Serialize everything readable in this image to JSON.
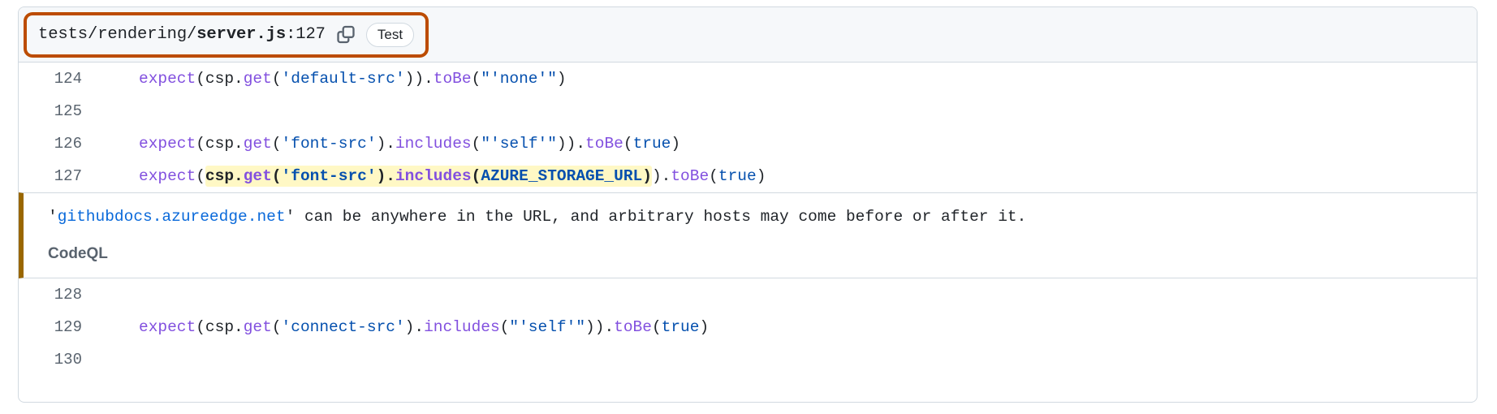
{
  "header": {
    "path_prefix": "tests/rendering/",
    "path_file": "server.js",
    "path_line": ":127",
    "copy_icon": "copy-icon",
    "badge_label": "Test"
  },
  "colors": {
    "focus_ring": "#bc4c00",
    "annotation_border": "#9a6700",
    "highlight": "#fff8c5",
    "link": "#0969da",
    "keyword": "#8250df",
    "string": "#0550ae",
    "header_bg": "#f6f8fa",
    "border": "#d1d9e0",
    "line_number": "#59636e"
  },
  "code": {
    "lines": [
      {
        "number": "124",
        "tokens": [
          {
            "text": "expect",
            "cls": "t-fn"
          },
          {
            "text": "(",
            "cls": "t-punct"
          },
          {
            "text": "csp",
            "cls": "t-id"
          },
          {
            "text": ".",
            "cls": "t-punct"
          },
          {
            "text": "get",
            "cls": "t-fn"
          },
          {
            "text": "(",
            "cls": "t-punct"
          },
          {
            "text": "'default-src'",
            "cls": "t-str"
          },
          {
            "text": "))",
            "cls": "t-punct"
          },
          {
            "text": ".",
            "cls": "t-punct"
          },
          {
            "text": "toBe",
            "cls": "t-fn"
          },
          {
            "text": "(",
            "cls": "t-punct"
          },
          {
            "text": "\"'none'\"",
            "cls": "t-str"
          },
          {
            "text": ")",
            "cls": "t-punct"
          }
        ]
      },
      {
        "number": "125",
        "tokens": []
      },
      {
        "number": "126",
        "tokens": [
          {
            "text": "expect",
            "cls": "t-fn"
          },
          {
            "text": "(",
            "cls": "t-punct"
          },
          {
            "text": "csp",
            "cls": "t-id"
          },
          {
            "text": ".",
            "cls": "t-punct"
          },
          {
            "text": "get",
            "cls": "t-fn"
          },
          {
            "text": "(",
            "cls": "t-punct"
          },
          {
            "text": "'font-src'",
            "cls": "t-str"
          },
          {
            "text": ")",
            "cls": "t-punct"
          },
          {
            "text": ".",
            "cls": "t-punct"
          },
          {
            "text": "includes",
            "cls": "t-fn"
          },
          {
            "text": "(",
            "cls": "t-punct"
          },
          {
            "text": "\"'self'\"",
            "cls": "t-str"
          },
          {
            "text": "))",
            "cls": "t-punct"
          },
          {
            "text": ".",
            "cls": "t-punct"
          },
          {
            "text": "toBe",
            "cls": "t-fn"
          },
          {
            "text": "(",
            "cls": "t-punct"
          },
          {
            "text": "true",
            "cls": "t-kw"
          },
          {
            "text": ")",
            "cls": "t-punct"
          }
        ]
      },
      {
        "number": "127",
        "highlighted": true,
        "tokens": [
          {
            "text": "expect",
            "cls": "t-fn"
          },
          {
            "text": "(",
            "cls": "t-punct"
          },
          {
            "text": "csp",
            "cls": "t-id",
            "hl": true
          },
          {
            "text": ".",
            "cls": "t-punct",
            "hl": true
          },
          {
            "text": "get",
            "cls": "t-fn",
            "hl": true
          },
          {
            "text": "(",
            "cls": "t-punct",
            "hl": true
          },
          {
            "text": "'font-src'",
            "cls": "t-str",
            "hl": true
          },
          {
            "text": ")",
            "cls": "t-punct",
            "hl": true
          },
          {
            "text": ".",
            "cls": "t-punct",
            "hl": true
          },
          {
            "text": "includes",
            "cls": "t-fn",
            "hl": true
          },
          {
            "text": "(",
            "cls": "t-punct",
            "hl": true
          },
          {
            "text": "AZURE_STORAGE_URL",
            "cls": "t-const",
            "hl": true
          },
          {
            "text": ")",
            "cls": "t-punct",
            "hl": true
          },
          {
            "text": ")",
            "cls": "t-punct"
          },
          {
            "text": ".",
            "cls": "t-punct"
          },
          {
            "text": "toBe",
            "cls": "t-fn"
          },
          {
            "text": "(",
            "cls": "t-punct"
          },
          {
            "text": "true",
            "cls": "t-kw"
          },
          {
            "text": ")",
            "cls": "t-punct"
          }
        ]
      }
    ],
    "lines_after": [
      {
        "number": "128",
        "tokens": []
      },
      {
        "number": "129",
        "tokens": [
          {
            "text": "expect",
            "cls": "t-fn"
          },
          {
            "text": "(",
            "cls": "t-punct"
          },
          {
            "text": "csp",
            "cls": "t-id"
          },
          {
            "text": ".",
            "cls": "t-punct"
          },
          {
            "text": "get",
            "cls": "t-fn"
          },
          {
            "text": "(",
            "cls": "t-punct"
          },
          {
            "text": "'connect-src'",
            "cls": "t-str"
          },
          {
            "text": ")",
            "cls": "t-punct"
          },
          {
            "text": ".",
            "cls": "t-punct"
          },
          {
            "text": "includes",
            "cls": "t-fn"
          },
          {
            "text": "(",
            "cls": "t-punct"
          },
          {
            "text": "\"'self'\"",
            "cls": "t-str"
          },
          {
            "text": "))",
            "cls": "t-punct"
          },
          {
            "text": ".",
            "cls": "t-punct"
          },
          {
            "text": "toBe",
            "cls": "t-fn"
          },
          {
            "text": "(",
            "cls": "t-punct"
          },
          {
            "text": "true",
            "cls": "t-kw"
          },
          {
            "text": ")",
            "cls": "t-punct"
          }
        ]
      },
      {
        "number": "130",
        "tokens": []
      }
    ]
  },
  "annotation": {
    "message_prefix": "'",
    "message_link": "githubdocs.azureedge.net",
    "message_suffix": "' can be anywhere in the URL, and arbitrary hosts may come before or after it.",
    "tool": "CodeQL"
  }
}
